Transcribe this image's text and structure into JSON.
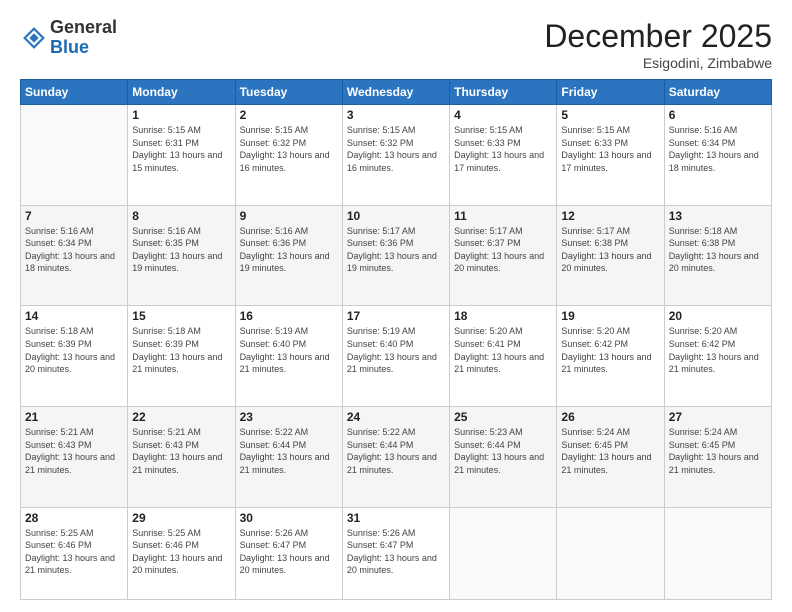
{
  "header": {
    "logo_general": "General",
    "logo_blue": "Blue",
    "month_title": "December 2025",
    "location": "Esigodini, Zimbabwe"
  },
  "days_of_week": [
    "Sunday",
    "Monday",
    "Tuesday",
    "Wednesday",
    "Thursday",
    "Friday",
    "Saturday"
  ],
  "weeks": [
    [
      {
        "day": "",
        "info": ""
      },
      {
        "day": "1",
        "info": "Sunrise: 5:15 AM\nSunset: 6:31 PM\nDaylight: 13 hours and 15 minutes."
      },
      {
        "day": "2",
        "info": "Sunrise: 5:15 AM\nSunset: 6:32 PM\nDaylight: 13 hours and 16 minutes."
      },
      {
        "day": "3",
        "info": "Sunrise: 5:15 AM\nSunset: 6:32 PM\nDaylight: 13 hours and 16 minutes."
      },
      {
        "day": "4",
        "info": "Sunrise: 5:15 AM\nSunset: 6:33 PM\nDaylight: 13 hours and 17 minutes."
      },
      {
        "day": "5",
        "info": "Sunrise: 5:15 AM\nSunset: 6:33 PM\nDaylight: 13 hours and 17 minutes."
      },
      {
        "day": "6",
        "info": "Sunrise: 5:16 AM\nSunset: 6:34 PM\nDaylight: 13 hours and 18 minutes."
      }
    ],
    [
      {
        "day": "7",
        "info": "Sunrise: 5:16 AM\nSunset: 6:34 PM\nDaylight: 13 hours and 18 minutes."
      },
      {
        "day": "8",
        "info": "Sunrise: 5:16 AM\nSunset: 6:35 PM\nDaylight: 13 hours and 19 minutes."
      },
      {
        "day": "9",
        "info": "Sunrise: 5:16 AM\nSunset: 6:36 PM\nDaylight: 13 hours and 19 minutes."
      },
      {
        "day": "10",
        "info": "Sunrise: 5:17 AM\nSunset: 6:36 PM\nDaylight: 13 hours and 19 minutes."
      },
      {
        "day": "11",
        "info": "Sunrise: 5:17 AM\nSunset: 6:37 PM\nDaylight: 13 hours and 20 minutes."
      },
      {
        "day": "12",
        "info": "Sunrise: 5:17 AM\nSunset: 6:38 PM\nDaylight: 13 hours and 20 minutes."
      },
      {
        "day": "13",
        "info": "Sunrise: 5:18 AM\nSunset: 6:38 PM\nDaylight: 13 hours and 20 minutes."
      }
    ],
    [
      {
        "day": "14",
        "info": "Sunrise: 5:18 AM\nSunset: 6:39 PM\nDaylight: 13 hours and 20 minutes."
      },
      {
        "day": "15",
        "info": "Sunrise: 5:18 AM\nSunset: 6:39 PM\nDaylight: 13 hours and 21 minutes."
      },
      {
        "day": "16",
        "info": "Sunrise: 5:19 AM\nSunset: 6:40 PM\nDaylight: 13 hours and 21 minutes."
      },
      {
        "day": "17",
        "info": "Sunrise: 5:19 AM\nSunset: 6:40 PM\nDaylight: 13 hours and 21 minutes."
      },
      {
        "day": "18",
        "info": "Sunrise: 5:20 AM\nSunset: 6:41 PM\nDaylight: 13 hours and 21 minutes."
      },
      {
        "day": "19",
        "info": "Sunrise: 5:20 AM\nSunset: 6:42 PM\nDaylight: 13 hours and 21 minutes."
      },
      {
        "day": "20",
        "info": "Sunrise: 5:20 AM\nSunset: 6:42 PM\nDaylight: 13 hours and 21 minutes."
      }
    ],
    [
      {
        "day": "21",
        "info": "Sunrise: 5:21 AM\nSunset: 6:43 PM\nDaylight: 13 hours and 21 minutes."
      },
      {
        "day": "22",
        "info": "Sunrise: 5:21 AM\nSunset: 6:43 PM\nDaylight: 13 hours and 21 minutes."
      },
      {
        "day": "23",
        "info": "Sunrise: 5:22 AM\nSunset: 6:44 PM\nDaylight: 13 hours and 21 minutes."
      },
      {
        "day": "24",
        "info": "Sunrise: 5:22 AM\nSunset: 6:44 PM\nDaylight: 13 hours and 21 minutes."
      },
      {
        "day": "25",
        "info": "Sunrise: 5:23 AM\nSunset: 6:44 PM\nDaylight: 13 hours and 21 minutes."
      },
      {
        "day": "26",
        "info": "Sunrise: 5:24 AM\nSunset: 6:45 PM\nDaylight: 13 hours and 21 minutes."
      },
      {
        "day": "27",
        "info": "Sunrise: 5:24 AM\nSunset: 6:45 PM\nDaylight: 13 hours and 21 minutes."
      }
    ],
    [
      {
        "day": "28",
        "info": "Sunrise: 5:25 AM\nSunset: 6:46 PM\nDaylight: 13 hours and 21 minutes."
      },
      {
        "day": "29",
        "info": "Sunrise: 5:25 AM\nSunset: 6:46 PM\nDaylight: 13 hours and 20 minutes."
      },
      {
        "day": "30",
        "info": "Sunrise: 5:26 AM\nSunset: 6:47 PM\nDaylight: 13 hours and 20 minutes."
      },
      {
        "day": "31",
        "info": "Sunrise: 5:26 AM\nSunset: 6:47 PM\nDaylight: 13 hours and 20 minutes."
      },
      {
        "day": "",
        "info": ""
      },
      {
        "day": "",
        "info": ""
      },
      {
        "day": "",
        "info": ""
      }
    ]
  ]
}
